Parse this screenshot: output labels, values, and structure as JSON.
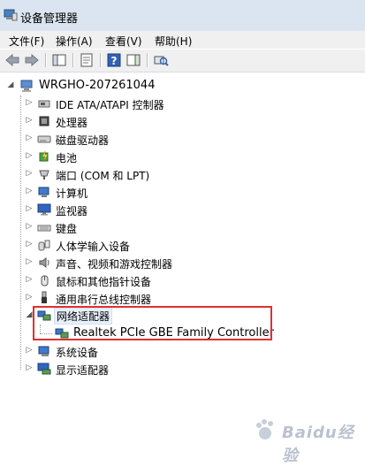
{
  "window": {
    "title": "设备管理器"
  },
  "menu": [
    "文件(F)",
    "操作(A)",
    "查看(V)",
    "帮助(H)"
  ],
  "toolbar": {
    "buttons": [
      "back-arrow-icon",
      "forward-arrow-icon",
      "console-tree-icon",
      "properties-icon",
      "help-icon",
      "action-pane-icon",
      "scan-hardware-icon"
    ]
  },
  "tree": {
    "root": "WRGHO-207261044",
    "categories": [
      "IDE ATA/ATAPI 控制器",
      "处理器",
      "磁盘驱动器",
      "电池",
      "端口 (COM 和 LPT)",
      "计算机",
      "监视器",
      "键盘",
      "人体学输入设备",
      "声音、视频和游戏控制器",
      "鼠标和其他指针设备",
      "通用串行总线控制器",
      "网络适配器",
      "系统设备",
      "显示适配器"
    ],
    "network_child": "Realtek PCIe GBE Family Controller"
  },
  "watermark": {
    "text": "Baidu经验"
  }
}
